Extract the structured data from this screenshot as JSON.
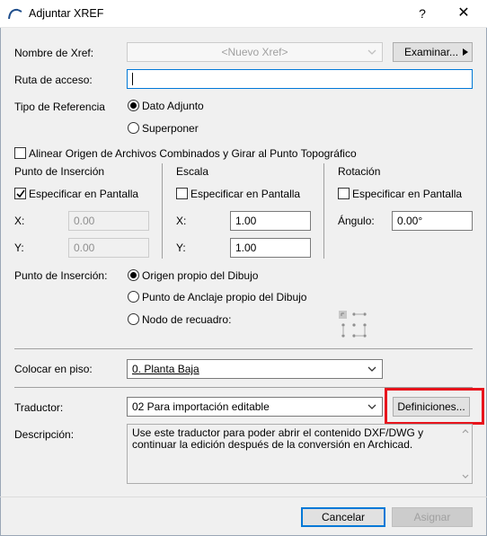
{
  "window": {
    "title": "Adjuntar XREF",
    "help_glyph": "?",
    "close_glyph": "✕"
  },
  "xref_name": {
    "label": "Nombre de Xref:",
    "value": "<Nuevo Xref>",
    "browse_label": "Examinar..."
  },
  "path": {
    "label": "Ruta de acceso:",
    "value": ""
  },
  "reference_type": {
    "label": "Tipo de Referencia",
    "options": [
      "Dato Adjunto",
      "Superponer"
    ],
    "selected": "Dato Adjunto"
  },
  "align_origin": {
    "label": "Alinear Origen de Archivos Combinados y Girar al Punto Topográfico",
    "checked": false
  },
  "insertion_point": {
    "title": "Punto de Inserción",
    "specify_label": "Especificar en Pantalla",
    "specify_checked": true,
    "x_label": "X:",
    "x_value": "0.00",
    "y_label": "Y:",
    "y_value": "0.00"
  },
  "scale": {
    "title": "Escala",
    "specify_label": "Especificar en Pantalla",
    "specify_checked": false,
    "x_label": "X:",
    "x_value": "1.00",
    "y_label": "Y:",
    "y_value": "1.00"
  },
  "rotation": {
    "title": "Rotación",
    "specify_label": "Especificar en Pantalla",
    "specify_checked": false,
    "angle_label": "Ángulo:",
    "angle_value": "0.00°"
  },
  "insertion_origin": {
    "label": "Punto de Inserción:",
    "options": [
      "Origen propio del Dibujo",
      "Punto de Anclaje propio del Dibujo",
      "Nodo de recuadro:"
    ],
    "selected": "Origen propio del Dibujo"
  },
  "floor": {
    "label": "Colocar en piso:",
    "value": "0. Planta Baja"
  },
  "translator": {
    "label": "Traductor:",
    "value": "02 Para importación editable",
    "settings_label": "Definiciones..."
  },
  "description": {
    "label": "Descripción:",
    "text": "Use este traductor para poder abrir el contenido DXF/DWG y continuar la edición después de la conversión en Archicad."
  },
  "footer": {
    "cancel_label": "Cancelar",
    "apply_label": "Asignar"
  },
  "colors": {
    "accent": "#0078d7",
    "highlight": "#e8141c",
    "dialog_bg": "#f0f0f0"
  }
}
